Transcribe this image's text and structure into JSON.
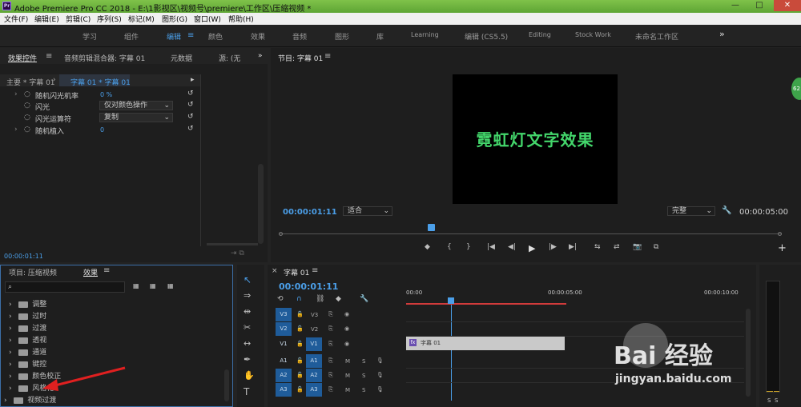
{
  "title": "Adobe Premiere Pro CC 2018 - E:\\1影视区\\视频号\\premiere\\工作区\\压缩视频 *",
  "app_badge": "Pr",
  "window_controls": [
    "—",
    "□",
    "✕"
  ],
  "menu": [
    "文件(F)",
    "编辑(E)",
    "剪辑(C)",
    "序列(S)",
    "标记(M)",
    "图形(G)",
    "窗口(W)",
    "帮助(H)"
  ],
  "workspaces": [
    "学习",
    "组件",
    "编辑",
    "颜色",
    "效果",
    "音频",
    "图形",
    "库",
    "Learning",
    "编辑 (CS5.5)",
    "Editing",
    "Stock Work",
    "未命名工作区"
  ],
  "workspace_more": "»",
  "effect_controls": {
    "tabs": [
      "效果控件",
      "音频剪辑混合器: 字幕 01",
      "元数据",
      "源: (无"
    ],
    "master_label": "主要 * 字幕 01",
    "clip_label": "字幕 01 * 字幕 01",
    "props": [
      {
        "name": "随机闪光机率",
        "value": "0 %"
      },
      {
        "name": "闪光",
        "value": "仅对颜色操作"
      },
      {
        "name": "闪光运算符",
        "value": "复制"
      },
      {
        "name": "随机植入",
        "value": "0"
      }
    ],
    "timecode": "00:00:01:11"
  },
  "program": {
    "title": "节目: 字幕 01",
    "video_text": "霓虹灯文字效果",
    "timecode": "00:00:01:11",
    "fit": "适合",
    "quality": "完整",
    "duration": "00:00:05:00",
    "controls": [
      "◆",
      "{",
      "}",
      "|◀",
      "◀|",
      "▶",
      "|▶",
      "▶|",
      "⇆",
      "⇄",
      "📷",
      "⧉"
    ],
    "plus": "+"
  },
  "project": {
    "tabs": [
      "项目: 压缩视频",
      "效果"
    ],
    "search_icon": "search-icon",
    "tree": [
      "调整",
      "过时",
      "过渡",
      "透视",
      "通道",
      "键控",
      "颜色校正",
      "风格化"
    ],
    "bottom_item": "视频过渡"
  },
  "timeline": {
    "title": "字幕 01",
    "timecode": "00:00:01:11",
    "ruler": [
      "00:00",
      "00:00:05:00",
      "00:00:10:00"
    ],
    "video_tracks": [
      {
        "src": "V3",
        "dst": "V3"
      },
      {
        "src": "V2",
        "dst": "V2"
      },
      {
        "src": "V1",
        "dst": "V1"
      }
    ],
    "audio_tracks": [
      {
        "src": "A1",
        "dst": "A1"
      },
      {
        "src": "A2",
        "dst": "A2"
      },
      {
        "src": "A3",
        "dst": "A3"
      }
    ],
    "mute": "M",
    "solo": "S",
    "clip_label": "字幕 01"
  },
  "meter": {
    "labels": [
      "S",
      "S"
    ]
  },
  "watermark": {
    "brand": "Bai 经验",
    "url": "jingyan.baidu.com"
  },
  "badge": "62"
}
